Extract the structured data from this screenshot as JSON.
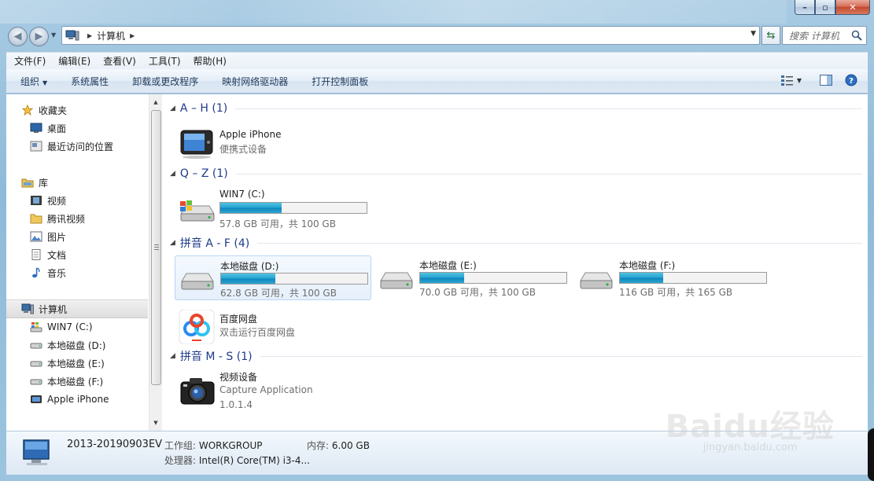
{
  "window": {
    "address_segments": [
      "计算机"
    ],
    "search_placeholder": "搜索 计算机",
    "caption": {
      "min": "–",
      "max": "▫",
      "close": "✕"
    }
  },
  "menubar": [
    {
      "label": "文件(F)"
    },
    {
      "label": "编辑(E)"
    },
    {
      "label": "查看(V)"
    },
    {
      "label": "工具(T)"
    },
    {
      "label": "帮助(H)"
    }
  ],
  "commandbar": [
    {
      "label": "组织",
      "has_dropdown": true
    },
    {
      "label": "系统属性"
    },
    {
      "label": "卸载或更改程序"
    },
    {
      "label": "映射网络驱动器"
    },
    {
      "label": "打开控制面板"
    }
  ],
  "navpane": {
    "favorites": {
      "label": "收藏夹",
      "items": [
        "桌面",
        "最近访问的位置"
      ]
    },
    "libraries": {
      "label": "库",
      "items": [
        "视频",
        "腾讯视频",
        "图片",
        "文档",
        "音乐"
      ]
    },
    "computer": {
      "label": "计算机",
      "items": [
        "WIN7 (C:)",
        "本地磁盘 (D:)",
        "本地磁盘 (E:)",
        "本地磁盘 (F:)",
        "Apple iPhone"
      ]
    }
  },
  "groups": [
    {
      "header": "A – H (1)"
    },
    {
      "header": "Q – Z (1)"
    },
    {
      "header": "拼音 A - F (4)"
    },
    {
      "header": "拼音 M - S (1)"
    }
  ],
  "items": {
    "iphone": {
      "name": "Apple iPhone",
      "sub": "便携式设备"
    },
    "c": {
      "name": "WIN7 (C:)",
      "free": "57.8 GB 可用，共 100 GB",
      "used_fraction": 0.422
    },
    "d": {
      "name": "本地磁盘 (D:)",
      "free": "62.8 GB 可用，共 100 GB",
      "used_fraction": 0.372
    },
    "e": {
      "name": "本地磁盘 (E:)",
      "free": "70.0 GB 可用，共 100 GB",
      "used_fraction": 0.3
    },
    "f": {
      "name": "本地磁盘 (F:)",
      "free": "116 GB 可用，共 165 GB",
      "used_fraction": 0.297
    },
    "baidu": {
      "name": "百度网盘",
      "sub": "双击运行百度网盘"
    },
    "video": {
      "name": "视频设备",
      "sub": "Capture Application",
      "version": "1.0.1.4"
    }
  },
  "details": {
    "name": "2013-20190903EV",
    "workgroup_label": "工作组:",
    "workgroup": "WORKGROUP",
    "memory_label": "内存:",
    "memory": "6.00 GB",
    "cpu_label": "处理器:",
    "cpu": "Intel(R) Core(TM) i3-4..."
  },
  "watermark": {
    "main": "Baidu经验",
    "sub": "jingyan.baidu.com"
  }
}
